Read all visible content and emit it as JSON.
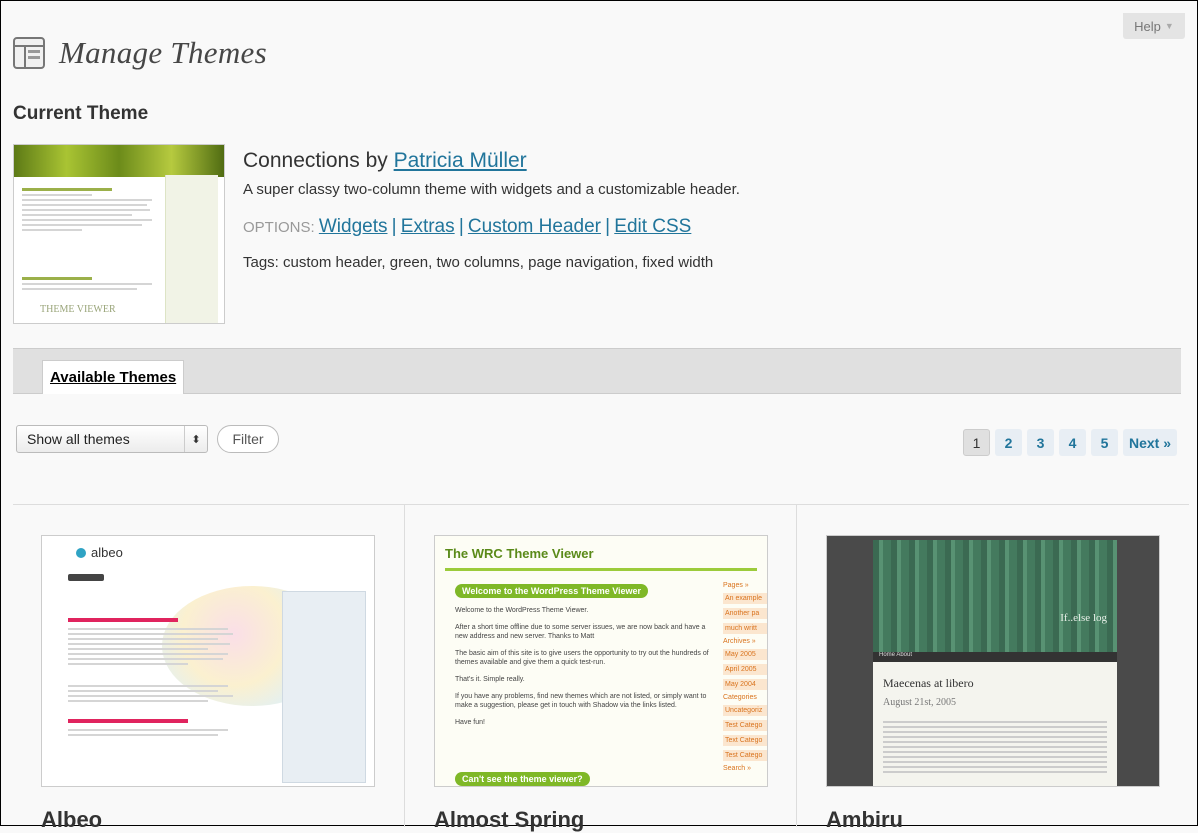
{
  "help": {
    "label": "Help"
  },
  "header": {
    "title": "Manage Themes"
  },
  "current": {
    "section_title": "Current Theme",
    "thumb": {
      "viewer_text": "THEME VIEWER"
    },
    "theme_name": "Connections",
    "by": "by",
    "author": "Patricia Müller",
    "description": "A super classy two-column theme with widgets and a customizable header.",
    "options_label": "OPTIONS:",
    "options": [
      "Widgets",
      "Extras",
      "Custom Header",
      "Edit CSS"
    ],
    "tags": "Tags: custom header, green, two columns, page navigation, fixed width"
  },
  "tabs": {
    "available": "Available Themes"
  },
  "filter": {
    "select_value": "Show all themes",
    "button": "Filter"
  },
  "pager": {
    "pages": [
      "1",
      "2",
      "3",
      "4",
      "5"
    ],
    "current": "1",
    "next": "Next »"
  },
  "themes": [
    {
      "name": "Albeo",
      "logo": "albeo"
    },
    {
      "name": "Almost Spring",
      "thumb": {
        "header": "The WRC Theme Viewer",
        "pill1": "Welcome to the WordPress Theme Viewer",
        "p1": "Welcome to the WordPress Theme Viewer.",
        "p2": "After a short time offline due to some server issues, we are now back and have a new address and new server. Thanks to Matt",
        "p3": "The basic aim of this site is to give users the opportunity to try out the hundreds of themes available and give them a quick test-run.",
        "p4": "That's it. Simple really.",
        "p5": "If you have any problems, find new themes which are not listed, or simply want to make a suggestion, please get in touch with Shadow via the links listed.",
        "p6": "Have fun!",
        "pill2": "Can't see the theme viewer?",
        "side": [
          "Pages »",
          "An example",
          "Another pa",
          "much writt",
          "Archives »",
          "May 2005",
          "April 2005",
          "May 2004",
          "Categories",
          "Uncategoriz",
          "Test Catego",
          "Text Catego",
          "Test Catego",
          "Search »"
        ]
      }
    },
    {
      "name": "Ambiru",
      "thumb": {
        "blog_name": "If..else log",
        "nav": "Home   About",
        "post_title": "Maecenas at libero",
        "post_date": "August 21st, 2005"
      }
    }
  ]
}
